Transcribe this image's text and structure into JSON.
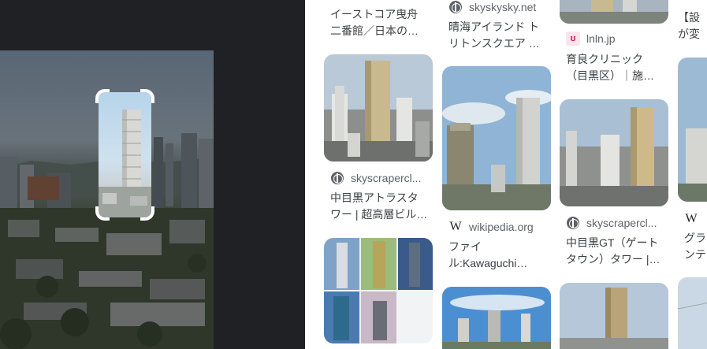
{
  "colors": {
    "viewer_bg": "#202124",
    "panel_bg": "#ffffff",
    "text": "#3c4043",
    "muted": "#5f6368"
  },
  "lens": {
    "selection_icon": "lens-selection-corners"
  },
  "results": [
    {
      "source": "",
      "source_icon": "none",
      "title_lines": [
        "イーストコア曳舟",
        "二番館／日本の…"
      ]
    },
    {
      "source": "skyskysky.net",
      "source_icon": "globe-icon",
      "title_lines": [
        "晴海アイランド ト",
        "リトンスクエア …"
      ]
    },
    {
      "source": "lnln.jp",
      "source_icon": "bunny-icon",
      "title_lines": [
        "育良クリニック",
        "（目黒区）｜施…"
      ]
    },
    {
      "source": "",
      "source_icon": "none",
      "title_lines": [
        "【設",
        "が変"
      ]
    },
    {
      "source": "skyscrapercl...",
      "source_icon": "globe-icon",
      "title_lines": [
        "中目黒アトラスタ",
        "ワー | 超高層ビル…"
      ]
    },
    {
      "source": "wikipedia.org",
      "source_icon": "wikipedia-icon",
      "title_lines": [
        "ファイ",
        "ル:Kawaguchi…"
      ]
    },
    {
      "source": "skyscrapercl...",
      "source_icon": "globe-icon",
      "title_lines": [
        "中目黒GT（ゲート",
        "タウン）タワー |…"
      ]
    },
    {
      "source": "W",
      "source_icon": "wikipedia-icon",
      "title_lines": [
        "グラ",
        "ンテ"
      ]
    }
  ]
}
